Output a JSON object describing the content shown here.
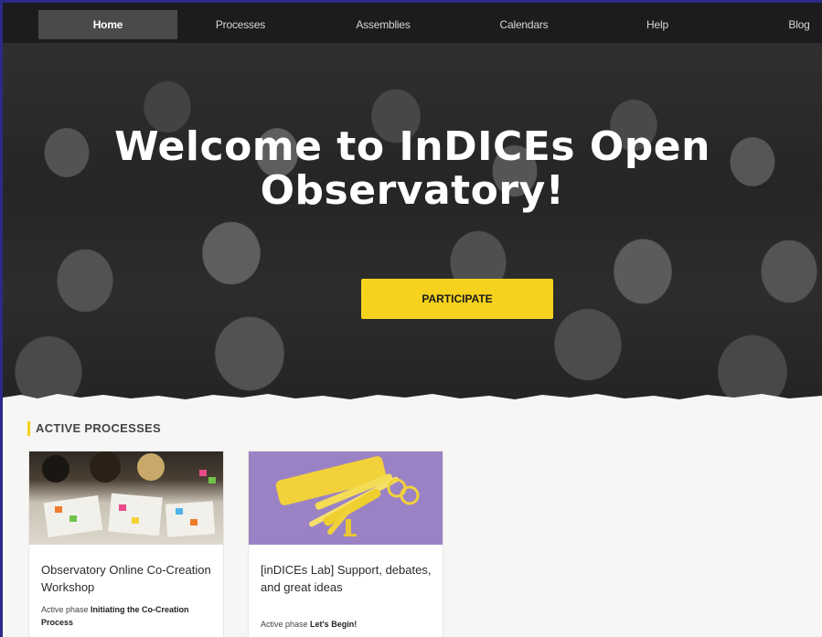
{
  "nav": {
    "items": [
      {
        "label": "Home",
        "active": true
      },
      {
        "label": "Processes",
        "active": false
      },
      {
        "label": "Assemblies",
        "active": false
      },
      {
        "label": "Calendars",
        "active": false
      },
      {
        "label": "Help",
        "active": false
      },
      {
        "label": "Blog",
        "active": false
      }
    ]
  },
  "hero": {
    "title_line1": "Welcome to InDICEs Open",
    "title_line2": "Observatory!",
    "button_label": "PARTICIPATE"
  },
  "processes": {
    "section_title": "ACTIVE PROCESSES",
    "cards": [
      {
        "title": "Observatory Online Co-Creation Workshop",
        "phase_prefix": "Active phase",
        "phase_name": "Initiating the Co-Creation Process"
      },
      {
        "title": "[inDICEs Lab] Support, debates, and great ideas",
        "phase_prefix": "Active phase",
        "phase_name": "Let's Begin!"
      }
    ]
  },
  "colors": {
    "accent": "#f5d21e",
    "nav_bg": "#1c1b1d",
    "frame_border": "#2b2a8a"
  }
}
